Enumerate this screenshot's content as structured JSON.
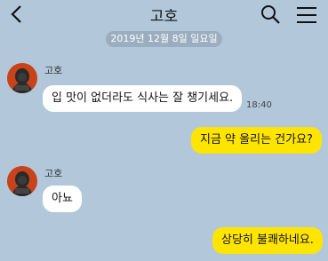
{
  "header": {
    "title": "고호",
    "back_icon": "back-arrow-icon",
    "search_icon": "search-icon",
    "menu_icon": "hamburger-menu-icon"
  },
  "date_divider": "2019년 12월  8일 일요일",
  "messages": [
    {
      "direction": "in",
      "sender": "고호",
      "text": "입 맛이 없더라도 식사는 잘 챙기세요.",
      "time": "18:40"
    },
    {
      "direction": "out",
      "text": "지금 약 올리는 건가요?"
    },
    {
      "direction": "in",
      "sender": "고호",
      "text": "아뇨"
    },
    {
      "direction": "out",
      "text": "상당히 불쾌하네요."
    }
  ],
  "colors": {
    "background": "#b2c7da",
    "incoming_bubble": "#ffffff",
    "outgoing_bubble": "#fee500",
    "avatar": "#c8421a"
  }
}
